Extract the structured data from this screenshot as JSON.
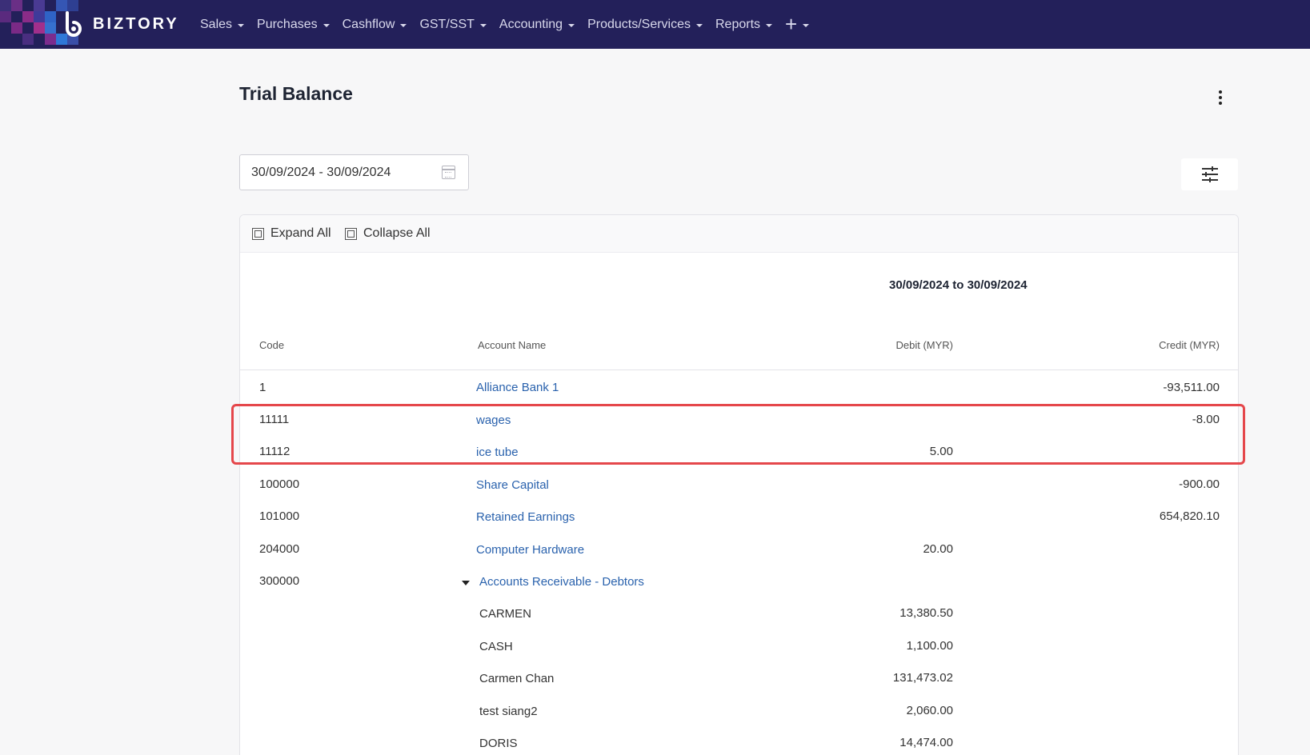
{
  "brand": {
    "name": "BIZTORY"
  },
  "nav": {
    "items": [
      {
        "label": "Sales"
      },
      {
        "label": "Purchases"
      },
      {
        "label": "Cashflow"
      },
      {
        "label": "GST/SST"
      },
      {
        "label": "Accounting"
      },
      {
        "label": "Products/Services"
      },
      {
        "label": "Reports"
      }
    ],
    "add_icon": "plus-icon"
  },
  "page": {
    "title": "Trial Balance",
    "date_range": "30/09/2024 - 30/09/2024",
    "more_icon": "kebab-menu-icon",
    "filter_icon": "sliders-icon"
  },
  "toolbar": {
    "expand_all": "Expand All",
    "collapse_all": "Collapse All"
  },
  "table": {
    "period": "30/09/2024 to 30/09/2024",
    "headers": {
      "code": "Code",
      "account": "Account Name",
      "debit": "Debit (MYR)",
      "credit": "Credit (MYR)"
    },
    "rows": [
      {
        "code": "1",
        "account": "Alliance Bank 1",
        "debit": "",
        "credit": "-93,511.00"
      },
      {
        "code": "11111",
        "account": "wages",
        "debit": "",
        "credit": "-8.00"
      },
      {
        "code": "11112",
        "account": "ice tube",
        "debit": "5.00",
        "credit": ""
      },
      {
        "code": "100000",
        "account": "Share Capital",
        "debit": "",
        "credit": "-900.00"
      },
      {
        "code": "101000",
        "account": "Retained Earnings",
        "debit": "",
        "credit": "654,820.10"
      },
      {
        "code": "204000",
        "account": "Computer Hardware",
        "debit": "20.00",
        "credit": ""
      },
      {
        "code": "300000",
        "account": "Accounts Receivable - Debtors",
        "debit": "",
        "credit": ""
      }
    ],
    "subrows": [
      {
        "name": "CARMEN",
        "debit": "13,380.50"
      },
      {
        "name": "CASH",
        "debit": "1,100.00"
      },
      {
        "name": "Carmen Chan",
        "debit": "131,473.02"
      },
      {
        "name": "test siang2",
        "debit": "2,060.00"
      },
      {
        "name": "DORIS",
        "debit": "14,474.00"
      }
    ]
  }
}
